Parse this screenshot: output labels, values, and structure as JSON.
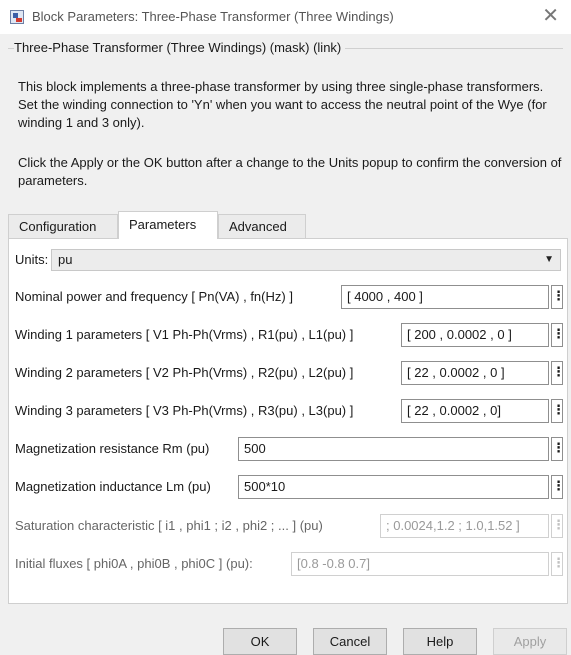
{
  "window": {
    "title": "Block Parameters: Three-Phase Transformer (Three Windings)",
    "close_glyph": "✕"
  },
  "group": {
    "legend": "Three-Phase Transformer (Three Windings) (mask) (link)",
    "description_1": "This block implements a three-phase transformer by using three single-phase transformers. Set the winding connection to 'Yn' when you want to access the neutral point of the Wye (for winding 1 and 3 only).",
    "description_2": "Click the Apply or the OK button after a change to the Units popup to confirm the conversion of parameters."
  },
  "tabs": [
    {
      "label": "Configuration"
    },
    {
      "label": "Parameters"
    },
    {
      "label": "Advanced"
    }
  ],
  "params": {
    "units_label": "Units:",
    "units_value": "pu",
    "nominal_label": "Nominal power and frequency  [ Pn(VA) , fn(Hz) ]",
    "nominal_value": "[ 4000 , 400 ]",
    "w1_label": "Winding 1 parameters [ V1 Ph-Ph(Vrms) , R1(pu) , L1(pu) ]",
    "w1_value": "[ 200 , 0.0002 , 0 ]",
    "w2_label": "Winding 2 parameters [ V2 Ph-Ph(Vrms) , R2(pu) , L2(pu) ]",
    "w2_value": "[ 22 , 0.0002 , 0 ]",
    "w3_label": "Winding 3 parameters [ V3 Ph-Ph(Vrms) , R3(pu) , L3(pu) ]",
    "w3_value": "[ 22 , 0.0002 , 0]",
    "rm_label": "Magnetization resistance  Rm (pu)",
    "rm_value": "500",
    "lm_label": "Magnetization inductance  Lm (pu)",
    "lm_value": "500*10",
    "sat_label": "Saturation characteristic [ i1 ,  phi1 ;  i2 , phi2 ; ... ] (pu)",
    "sat_value": "; 0.0024,1.2 ; 1.0,1.52 ]",
    "flux_label": "Initial fluxes [ phi0A , phi0B , phi0C ] (pu):",
    "flux_value": "[0.8 -0.8 0.7]",
    "menu_glyph": "⋮"
  },
  "buttons": {
    "ok": "OK",
    "cancel": "Cancel",
    "help": "Help",
    "apply": "Apply"
  }
}
